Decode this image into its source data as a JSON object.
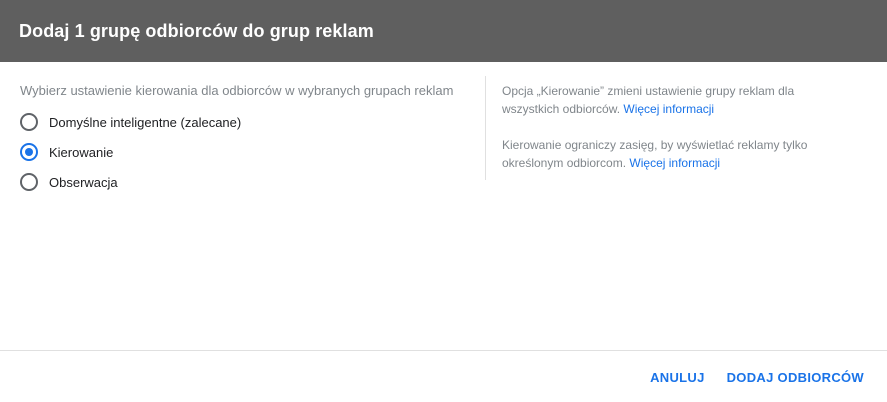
{
  "dialog": {
    "title": "Dodaj 1 grupę odbiorców do grup reklam"
  },
  "targeting": {
    "prompt": "Wybierz ustawienie kierowania dla odbiorców w wybranych grupach reklam",
    "options": [
      {
        "label": "Domyślne inteligentne (zalecane)",
        "selected": false
      },
      {
        "label": "Kierowanie",
        "selected": true
      },
      {
        "label": "Obserwacja",
        "selected": false
      }
    ]
  },
  "help": {
    "text1": "Opcja „Kierowanie” zmieni ustawienie grupy reklam dla wszystkich odbiorców.",
    "link1": "Więcej informacji",
    "text2": "Kierowanie ograniczy zasięg, by wyświetlać reklamy tylko określonym odbiorcom.",
    "link2": "Więcej informacji"
  },
  "footer": {
    "cancel_label": "ANULUJ",
    "submit_label": "DODAJ ODBIORCÓW"
  },
  "colors": {
    "header_bg": "#5f5f5f",
    "accent": "#1a73e8"
  }
}
